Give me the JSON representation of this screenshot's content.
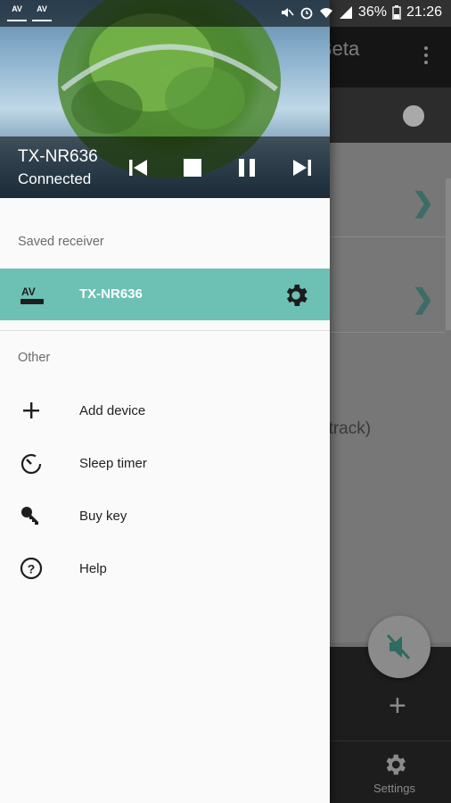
{
  "status_bar": {
    "left_icons": [
      "AV",
      "AV"
    ],
    "battery": "36%",
    "time": "21:26"
  },
  "background_app": {
    "title_partial": "Beta",
    "list_text_partial": "dtrack)",
    "bottom_nav_label": "Settings"
  },
  "drawer": {
    "header": {
      "receiver_name": "TX-NR636",
      "connection_status": "Connected"
    },
    "saved_section_label": "Saved receiver",
    "saved_receiver": {
      "name": "TX-NR636"
    },
    "other_section_label": "Other",
    "menu_items": [
      {
        "label": "Add device",
        "icon": "plus-icon"
      },
      {
        "label": "Sleep timer",
        "icon": "timer-icon"
      },
      {
        "label": "Buy key",
        "icon": "key-icon"
      },
      {
        "label": "Help",
        "icon": "help-icon"
      }
    ]
  },
  "colors": {
    "accent": "#6cc0b4",
    "drawer_bg": "#fafafa",
    "chevron": "#3e6b66"
  }
}
